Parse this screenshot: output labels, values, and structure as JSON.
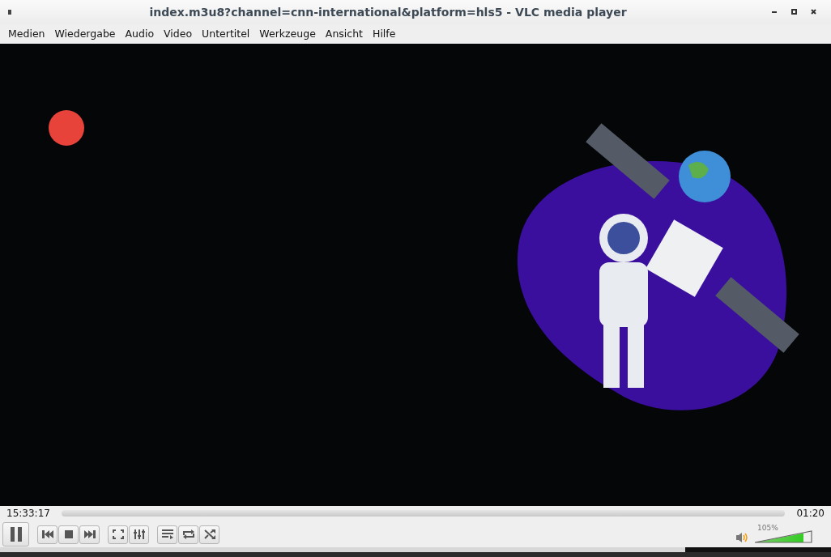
{
  "window": {
    "title": "index.m3u8?channel=cnn-international&platform=hls5 - VLC media player"
  },
  "menu": [
    {
      "label": "Medien"
    },
    {
      "label": "Wiedergabe"
    },
    {
      "label": "Audio"
    },
    {
      "label": "Video"
    },
    {
      "label": "Untertitel"
    },
    {
      "label": "Werkzeuge"
    },
    {
      "label": "Ansicht"
    },
    {
      "label": "Hilfe"
    }
  ],
  "seek": {
    "elapsed": "15:33:17",
    "total": "01:20"
  },
  "controls": {
    "playing": true
  },
  "volume": {
    "reading": "105%"
  }
}
